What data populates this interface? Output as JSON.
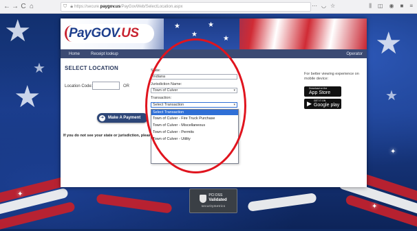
{
  "browser": {
    "url_prefix": "https://secure.",
    "url_domain": "paygov.us",
    "url_path": "/PayGovWeb/SelectLocation.aspx",
    "nav_back": "←",
    "nav_forward": "→",
    "nav_reload": "C",
    "nav_home": "⌂"
  },
  "logo": {
    "pay": "Pay",
    "gov": "GOV",
    "us": ".US"
  },
  "menu": {
    "items": [
      {
        "label": "Home"
      },
      {
        "label": "Receipt lookup"
      }
    ],
    "operator": "Operator"
  },
  "page": {
    "title": "SELECT LOCATION",
    "location_code_label": "Location Code:",
    "or_label": "OR",
    "pay_button": "Make A Payment",
    "notice": "If you do not see your state or jurisdiction, please"
  },
  "form": {
    "state_label": "State:",
    "state_value": "Indiana",
    "jurisdiction_label": "Jurisdiction Name:",
    "jurisdiction_value": "Town of Culver",
    "transaction_label": "Transaction:",
    "transaction_value": "Select Transaction",
    "transaction_options": [
      "Select Transaction",
      "Town of Culver - Fire Truck Purchase",
      "Town of Culver - Miscellaneous",
      "Town of Culver - Permits",
      "Town of Culver - Utility"
    ]
  },
  "sidebar": {
    "note": "For better viewing experience on mobile device:",
    "app_store_small": "Download on the",
    "app_store_big": "App Store",
    "google_small": "GET IT ON",
    "google_big": "Google play"
  },
  "badge": {
    "pci": "PCI DSS",
    "validated": "Validated",
    "security": "securitymetrics"
  },
  "colors": {
    "annotation": "#e0141e",
    "menu_bg": "#3b4a73",
    "button_bg": "#2d4678",
    "selected_option": "#2f6fd6"
  }
}
